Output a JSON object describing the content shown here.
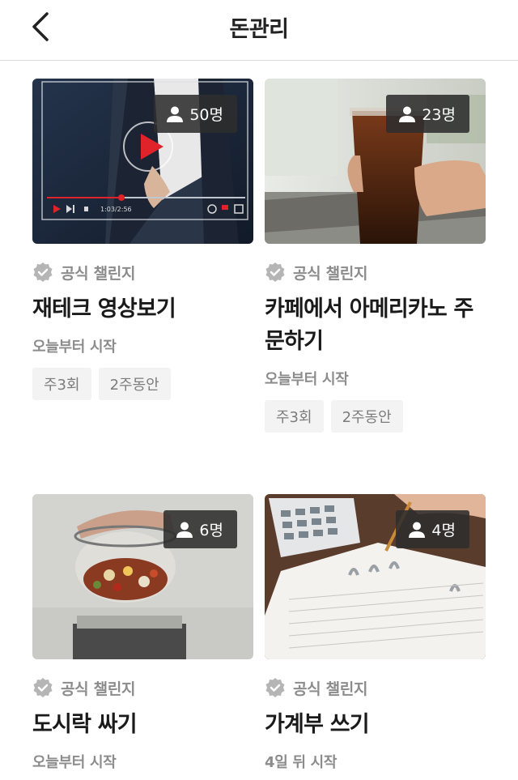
{
  "header": {
    "title": "돈관리"
  },
  "cards": [
    {
      "participants": "50명",
      "official_label": "공식 챌린지",
      "title": "재테크 영상보기",
      "start": "오늘부터 시작",
      "tags": [
        "주3회",
        "2주동안"
      ],
      "image": "video-player-image"
    },
    {
      "participants": "23명",
      "official_label": "공식 챌린지",
      "title": "카페에서 아메리카노 주문하기",
      "start": "오늘부터 시작",
      "tags": [
        "주3회",
        "2주동안"
      ],
      "image": "iced-americano-image"
    },
    {
      "participants": "6명",
      "official_label": "공식 챌린지",
      "title": "도시락 싸기",
      "start": "오늘부터 시작",
      "tags": [],
      "image": "lunchbox-image"
    },
    {
      "participants": "4명",
      "official_label": "공식 챌린지",
      "title": "가계부 쓰기",
      "start": "4일 뒤 시작",
      "tags": [],
      "image": "account-book-image"
    }
  ],
  "video_time": "1:03/2:56",
  "colors": {
    "badge_bg": "#2d2d2d",
    "check_gray": "#b5b5b5",
    "tag_bg": "#f3f3f3"
  }
}
